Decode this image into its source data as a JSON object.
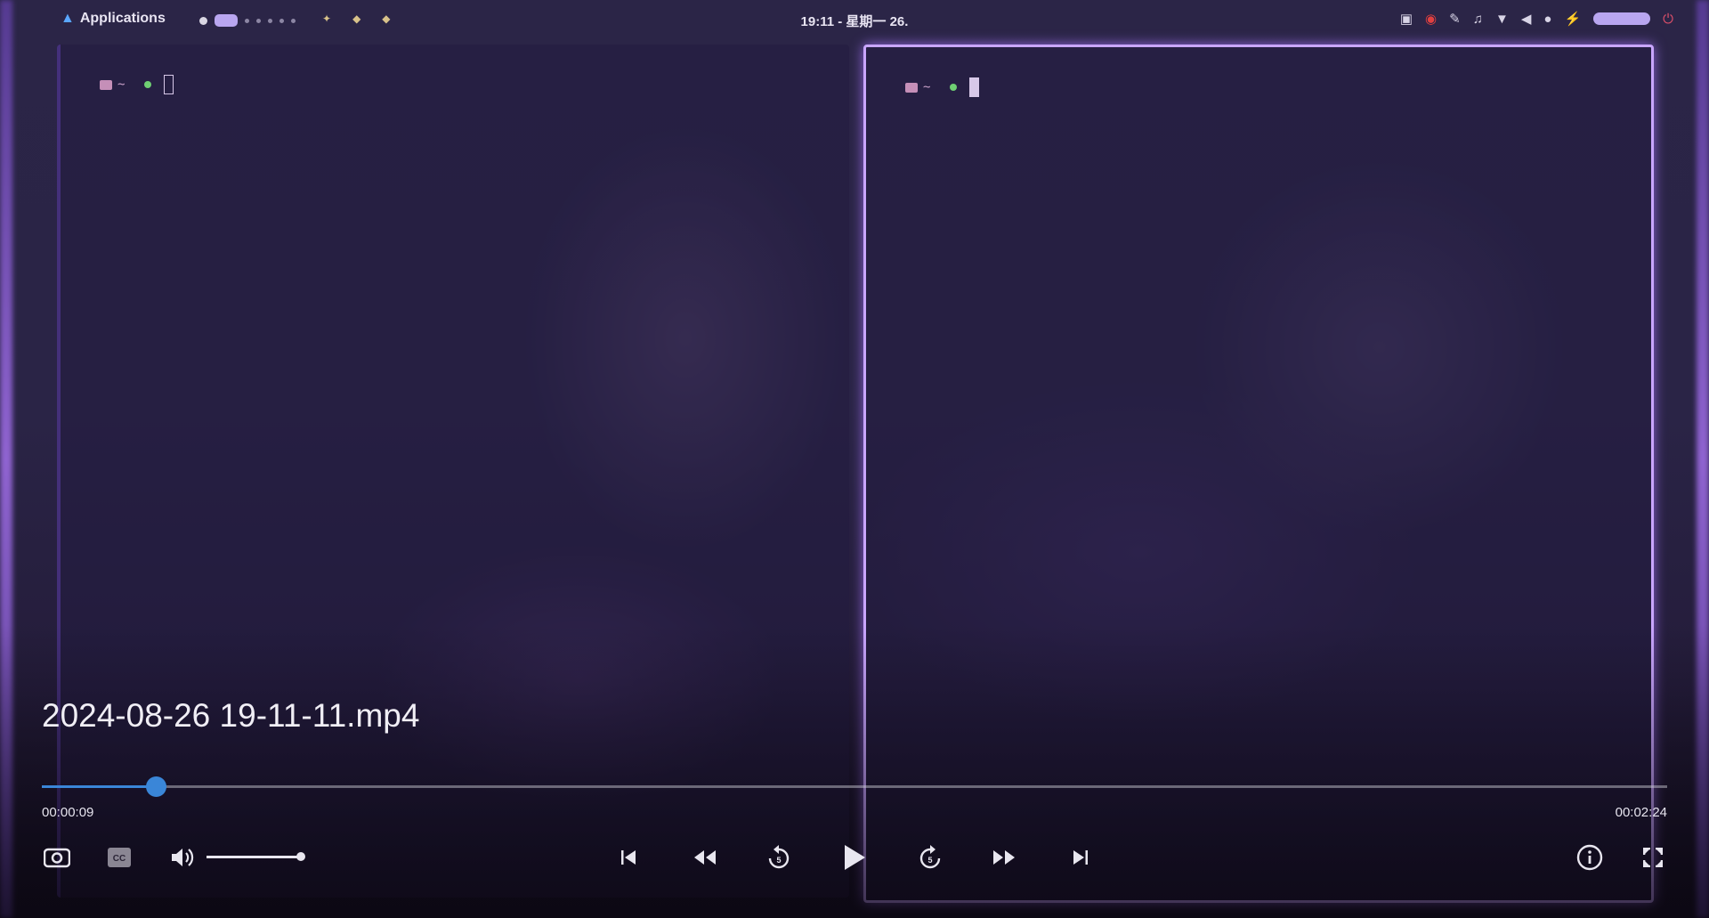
{
  "topbar": {
    "applications_label": "Applications",
    "clock": "19:11 - 星期一 26."
  },
  "terminals": [
    {
      "path": "~"
    },
    {
      "path": "~"
    }
  ],
  "player": {
    "filename": "2024-08-26 19-11-11.mp4",
    "current_time": "00:00:09",
    "duration": "00:02:24",
    "progress_fraction": 0.07,
    "volume_fraction": 1.0,
    "accent_color": "#3a86d8"
  }
}
